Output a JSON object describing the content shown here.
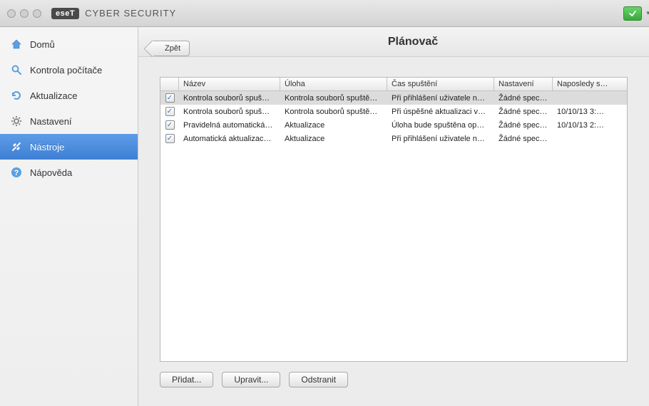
{
  "titlebar": {
    "brand_badge": "eseT",
    "brand_title": "CYBER SECURITY"
  },
  "sidebar": {
    "items": [
      {
        "label": "Domů"
      },
      {
        "label": "Kontrola počítače"
      },
      {
        "label": "Aktualizace"
      },
      {
        "label": "Nastavení"
      },
      {
        "label": "Nástroje"
      },
      {
        "label": "Nápověda"
      }
    ]
  },
  "header": {
    "back_label": "Zpět",
    "page_title": "Plánovač"
  },
  "table": {
    "columns": {
      "name": "Název",
      "task": "Úloha",
      "time": "Čas spuštění",
      "settings": "Nastavení",
      "last": "Naposledy s…"
    },
    "rows": [
      {
        "checked": true,
        "name": "Kontrola souborů spuš…",
        "task": "Kontrola souborů spuště…",
        "time": "Při přihlášení uživatele n…",
        "settings": "Žádné speci…",
        "last": ""
      },
      {
        "checked": true,
        "name": "Kontrola souborů spuš…",
        "task": "Kontrola souborů spuště…",
        "time": "Při úspěšné aktualizaci v…",
        "settings": "Žádné speci…",
        "last": "10/10/13 3:…"
      },
      {
        "checked": true,
        "name": "Pravidelná automatická…",
        "task": "Aktualizace",
        "time": "Úloha bude spuštěna op…",
        "settings": "Žádné speci…",
        "last": "10/10/13 2:…"
      },
      {
        "checked": true,
        "name": "Automatická aktualizac…",
        "task": "Aktualizace",
        "time": "Při přihlášení uživatele n…",
        "settings": "Žádné speci…",
        "last": ""
      }
    ]
  },
  "buttons": {
    "add": "Přidat...",
    "edit": "Upravit...",
    "remove": "Odstranit"
  }
}
